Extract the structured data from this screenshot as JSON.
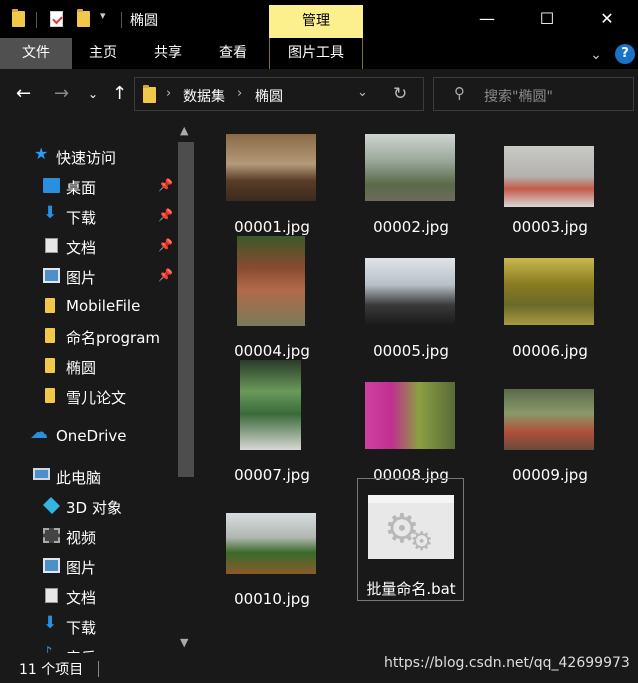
{
  "titlebar": {
    "title": "椭圆",
    "context_tab": "管理",
    "minimize_glyph": "—",
    "maximize_glyph": "☐",
    "close_glyph": "✕"
  },
  "ribbon": {
    "tabs": [
      "文件",
      "主页",
      "共享",
      "查看",
      "图片工具"
    ],
    "active_tab": "文件",
    "help_glyph": "?"
  },
  "address": {
    "crumbs": [
      "数据集",
      "椭圆"
    ],
    "search_placeholder": "搜索\"椭圆\""
  },
  "sidebar": {
    "quick_access": "快速访问",
    "items": [
      {
        "label": "桌面",
        "icon": "desktop-icon",
        "pinned": true
      },
      {
        "label": "下载",
        "icon": "download-icon",
        "pinned": true
      },
      {
        "label": "文档",
        "icon": "document-icon",
        "pinned": true
      },
      {
        "label": "图片",
        "icon": "pictures-icon",
        "pinned": true
      },
      {
        "label": "MobileFile",
        "icon": "folder-icon",
        "pinned": false
      },
      {
        "label": "命名program",
        "icon": "folder-icon",
        "pinned": false
      },
      {
        "label": "椭圆",
        "icon": "folder-icon",
        "pinned": false
      },
      {
        "label": "雪儿论文",
        "icon": "folder-icon",
        "pinned": false
      }
    ],
    "onedrive": "OneDrive",
    "this_pc": "此电脑",
    "pc_items": [
      {
        "label": "3D 对象",
        "icon": "3d-objects-icon"
      },
      {
        "label": "视频",
        "icon": "video-icon"
      },
      {
        "label": "图片",
        "icon": "pictures-icon"
      },
      {
        "label": "文档",
        "icon": "document-icon"
      },
      {
        "label": "下载",
        "icon": "download-icon"
      },
      {
        "label": "音乐",
        "icon": "music-icon"
      }
    ]
  },
  "files": [
    {
      "name": "00001.jpg"
    },
    {
      "name": "00002.jpg"
    },
    {
      "name": "00003.jpg"
    },
    {
      "name": "00004.jpg"
    },
    {
      "name": "00005.jpg"
    },
    {
      "name": "00006.jpg"
    },
    {
      "name": "00007.jpg"
    },
    {
      "name": "00008.jpg"
    },
    {
      "name": "00009.jpg"
    },
    {
      "name": "00010.jpg"
    },
    {
      "name": "批量命名.bat"
    }
  ],
  "status": {
    "item_count": "11 个项目",
    "watermark": "https://blog.csdn.net/qq_42699973"
  }
}
